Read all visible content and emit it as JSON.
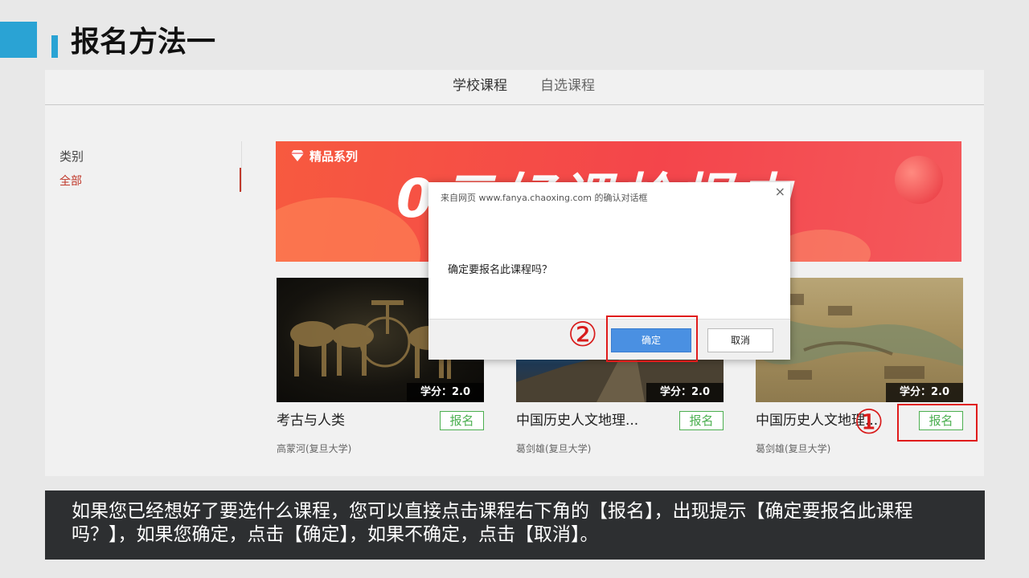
{
  "slide_title": "报名方法一",
  "tabs": {
    "school": "学校课程",
    "self": "自选课程"
  },
  "sidebar": {
    "heading": "类别",
    "items": [
      {
        "label": "全部"
      }
    ]
  },
  "banner": {
    "gem_icon": "diamond-icon",
    "series_label": "精品系列",
    "slogan": "0元好课抢报中"
  },
  "courses": [
    {
      "name": "考古与人类",
      "teacher": "高蒙河(复旦大学)",
      "credit": "学分：2.0",
      "enroll_label": "报名"
    },
    {
      "name": "中国历史人文地理...",
      "teacher": "葛剑雄(复旦大学)",
      "credit": "学分：2.0",
      "enroll_label": "报名"
    },
    {
      "name": "中国历史人文地理...",
      "teacher": "葛剑雄(复旦大学)",
      "credit": "学分：2.0",
      "enroll_label": "报名"
    }
  ],
  "dialog": {
    "header": "来自网页 www.fanya.chaoxing.com 的确认对话框",
    "close_glyph": "×",
    "message": "确定要报名此课程吗？",
    "ok_label": "确定",
    "cancel_label": "取消"
  },
  "markers": {
    "one": "①",
    "two": "②"
  },
  "instruction": "如果您已经想好了要选什么课程，您可以直接点击课程右下角的【报名】，出现提示【确定要报名此课程吗？】，如果您确定，点击【确定】，如果不确定，点击【取消】。",
  "colors": {
    "accent": "#2aa3d4",
    "banner": "#f4454b",
    "enroll": "#4caf50",
    "annotation": "#e01b1b",
    "ok_button": "#4a90e2"
  }
}
